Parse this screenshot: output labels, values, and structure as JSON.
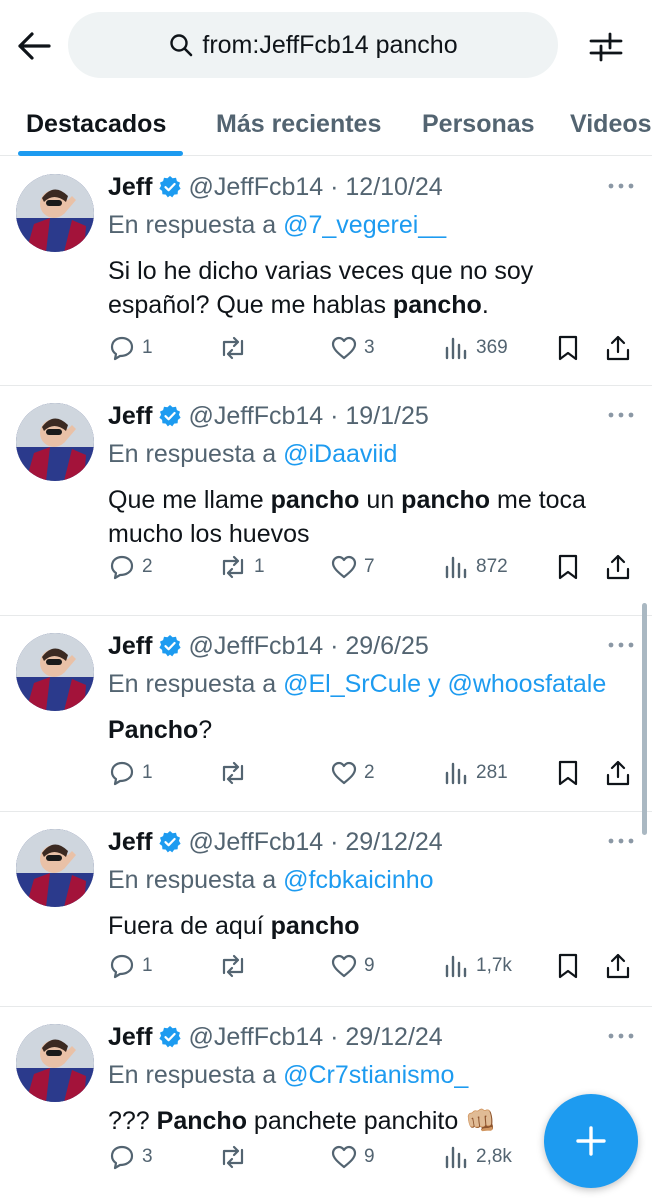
{
  "header": {
    "search_query": "from:JeffFcb14 pancho"
  },
  "tabs": [
    {
      "label": "Destacados",
      "active": true
    },
    {
      "label": "Más recientes",
      "active": false
    },
    {
      "label": "Personas",
      "active": false
    },
    {
      "label": "Videos",
      "active": false
    }
  ],
  "colors": {
    "accent": "#1d9bf0",
    "text": "#0f1419",
    "muted": "#536471"
  },
  "tweets": [
    {
      "name": "Jeff",
      "handle": "@JeffFcb14 · 12/10/24",
      "reply_prefix": "En respuesta a ",
      "reply_mentions": "@7_vegerei__",
      "text_parts": [
        "Si lo he dicho varias veces que no soy español? Que me hablas ",
        "pancho",
        "."
      ],
      "replies": "1",
      "reposts": "",
      "likes": "3",
      "views": "369"
    },
    {
      "name": "Jeff",
      "handle": "@JeffFcb14 · 19/1/25",
      "reply_prefix": "En respuesta a ",
      "reply_mentions": "@iDaaviid",
      "text_parts": [
        "Que me llame ",
        "pancho",
        " un ",
        "pancho",
        " me toca mucho los huevos"
      ],
      "replies": "2",
      "reposts": "1",
      "likes": "7",
      "views": "872"
    },
    {
      "name": "Jeff",
      "handle": "@JeffFcb14 · 29/6/25",
      "reply_prefix": "En respuesta a ",
      "reply_mentions": "@El_SrCule y @whoosfatale",
      "text_parts": [
        "",
        "Pancho",
        "?"
      ],
      "replies": "1",
      "reposts": "",
      "likes": "2",
      "views": "281"
    },
    {
      "name": "Jeff",
      "handle": "@JeffFcb14 · 29/12/24",
      "reply_prefix": "En respuesta a ",
      "reply_mentions": "@fcbkaicinho",
      "text_parts": [
        "Fuera de aquí ",
        "pancho",
        ""
      ],
      "replies": "1",
      "reposts": "",
      "likes": "9",
      "views": "1,7k"
    },
    {
      "name": "Jeff",
      "handle": "@JeffFcb14 · 29/12/24",
      "reply_prefix": "En respuesta a ",
      "reply_mentions": "@Cr7stianismo_",
      "text_parts": [
        "??? ",
        "Pancho",
        " panchete panchito 👊🏼"
      ],
      "replies": "3",
      "reposts": "",
      "likes": "9",
      "views": "2,8k"
    }
  ]
}
